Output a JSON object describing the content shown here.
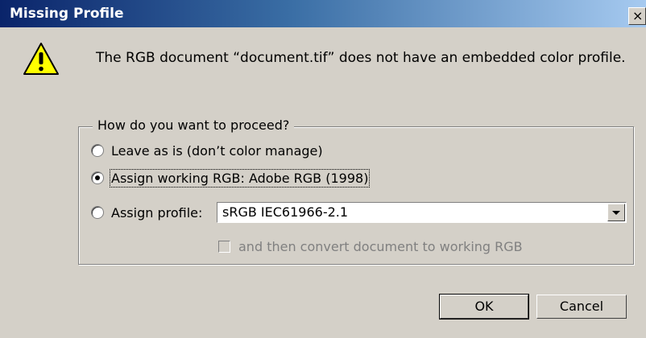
{
  "window": {
    "title": "Missing Profile",
    "close_label": "×"
  },
  "message": "The RGB document “document.tif” does not have an embedded color profile.",
  "group": {
    "legend": "How do you want to proceed?",
    "options": [
      {
        "label": "Leave as is (don’t color manage)",
        "checked": false
      },
      {
        "label": "Assign working RGB:  Adobe RGB (1998)",
        "checked": true
      },
      {
        "label": "Assign profile:",
        "checked": false
      }
    ],
    "profile_select_value": "sRGB IEC61966-2.1",
    "convert_checkbox_label": "and then convert document to working RGB",
    "convert_checked": false,
    "convert_enabled": false
  },
  "buttons": {
    "ok": "OK",
    "cancel": "Cancel"
  },
  "icons": {
    "warning": "warning-icon",
    "dropdown": "chevron-down-icon"
  },
  "colors": {
    "titlebar_start": "#0a246a",
    "titlebar_end": "#a6caf0",
    "dialog_bg": "#d4d0c8",
    "warning_yellow": "#ffff00"
  }
}
